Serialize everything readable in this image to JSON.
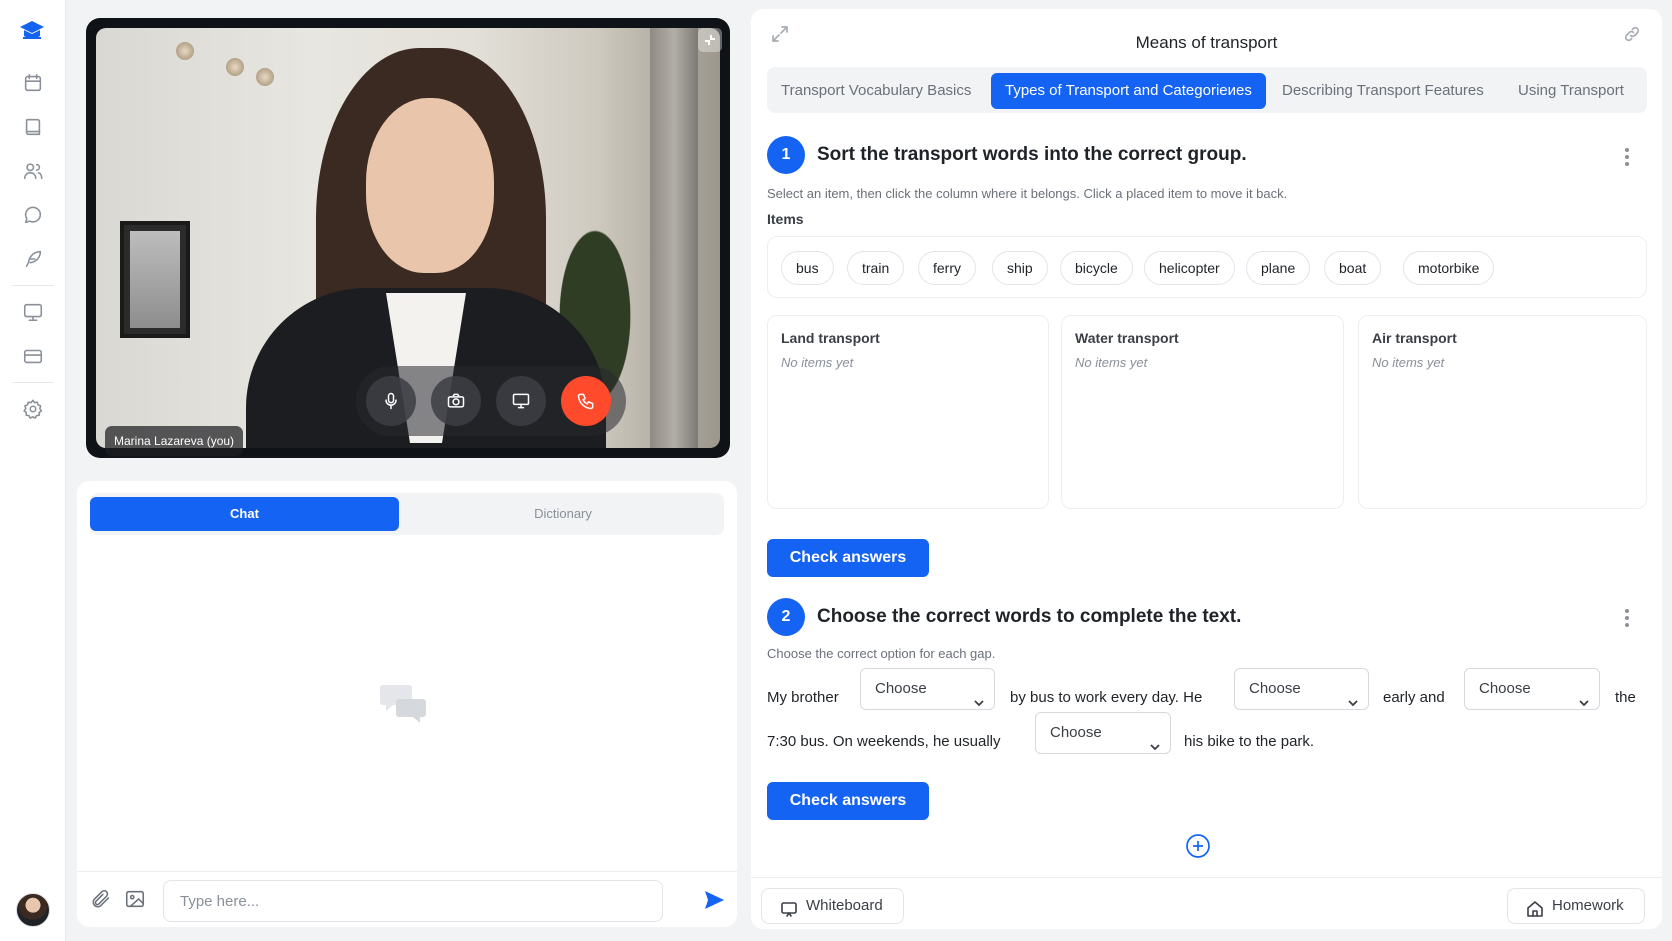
{
  "video": {
    "participant_name": "Marina Lazareva (you)"
  },
  "chat": {
    "tabs": [
      "Chat",
      "Dictionary"
    ],
    "input_placeholder": "Type here..."
  },
  "lesson": {
    "title": "Means of transport",
    "subtabs": [
      "Transport Vocabulary Basics",
      "Types of Transport and Categorieиes",
      "Describing Transport Features",
      "Using Transport"
    ],
    "active_subtab_index": 1,
    "exercise1": {
      "number": "1",
      "title": "Sort the transport words into the correct group.",
      "instruction": "Select an item, then click the column where it belongs. Click a placed item to move it back.",
      "items_label": "Items",
      "items": [
        "bus",
        "train",
        "ferry",
        "ship",
        "bicycle",
        "helicopter",
        "plane",
        "boat",
        "motorbike"
      ],
      "columns": [
        {
          "title": "Land transport",
          "empty_text": "No items yet"
        },
        {
          "title": "Water transport",
          "empty_text": "No items yet"
        },
        {
          "title": "Air transport",
          "empty_text": "No items yet"
        }
      ],
      "check_label": "Check answers"
    },
    "exercise2": {
      "number": "2",
      "title": "Choose the correct words to complete the text.",
      "instruction": "Choose the correct option for each gap.",
      "text_parts": [
        "My brother",
        "by bus to work every day. He",
        "early and",
        "the",
        "7:30 bus. On weekends, he usually",
        "his bike to the park."
      ],
      "select_placeholder": "Choose",
      "check_label": "Check answers"
    },
    "bottom": {
      "whiteboard_label": "Whiteboard",
      "homework_label": "Homework"
    }
  },
  "colors": {
    "accent": "#1463f3",
    "end_call": "#ff4a2b"
  }
}
